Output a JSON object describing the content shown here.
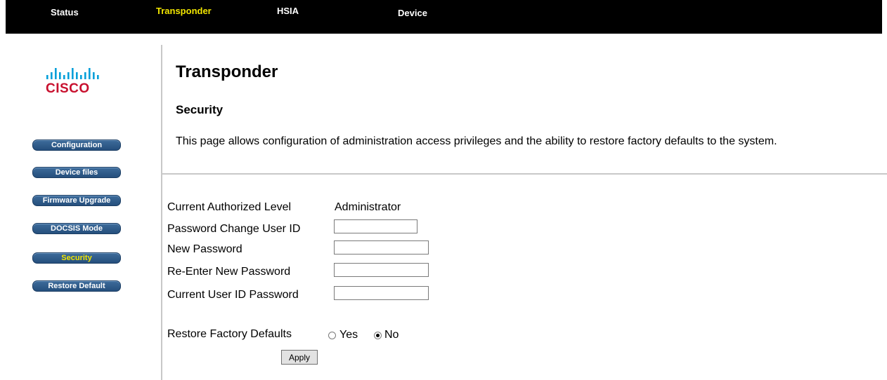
{
  "topnav": {
    "items": [
      {
        "label": "Status",
        "active": false
      },
      {
        "label": "Transponder",
        "active": true
      },
      {
        "label": "HSIA",
        "active": false
      },
      {
        "label": "Device",
        "active": false
      }
    ]
  },
  "logo": {
    "text": "CISCO",
    "icon": "cisco-bars-icon"
  },
  "sidebar": {
    "items": [
      {
        "label": "Configuration",
        "active": false
      },
      {
        "label": "Device files",
        "active": false
      },
      {
        "label": "Firmware Upgrade",
        "active": false
      },
      {
        "label": "DOCSIS Mode",
        "active": false
      },
      {
        "label": "Security",
        "active": true
      },
      {
        "label": "Restore Default",
        "active": false
      }
    ]
  },
  "main": {
    "title": "Transponder",
    "subtitle": "Security",
    "description": "This page allows configuration of administration access privileges and the ability to restore factory defaults to the system."
  },
  "form": {
    "current_level_label": "Current Authorized Level",
    "current_level_value": "Administrator",
    "user_id_label": "Password Change User ID",
    "user_id_value": "",
    "new_password_label": "New Password",
    "new_password_value": "",
    "reenter_password_label": "Re-Enter New Password",
    "reenter_password_value": "",
    "current_password_label": "Current User ID Password",
    "current_password_value": "",
    "restore_label": "Restore Factory Defaults",
    "restore_yes": "Yes",
    "restore_no": "No",
    "restore_selected": "No",
    "apply_label": "Apply"
  },
  "colors": {
    "nav_bg": "#000000",
    "nav_active": "#f2e600",
    "side_button": "#2d5a88",
    "logo_red": "#c8102e",
    "logo_blue": "#049fd9"
  }
}
